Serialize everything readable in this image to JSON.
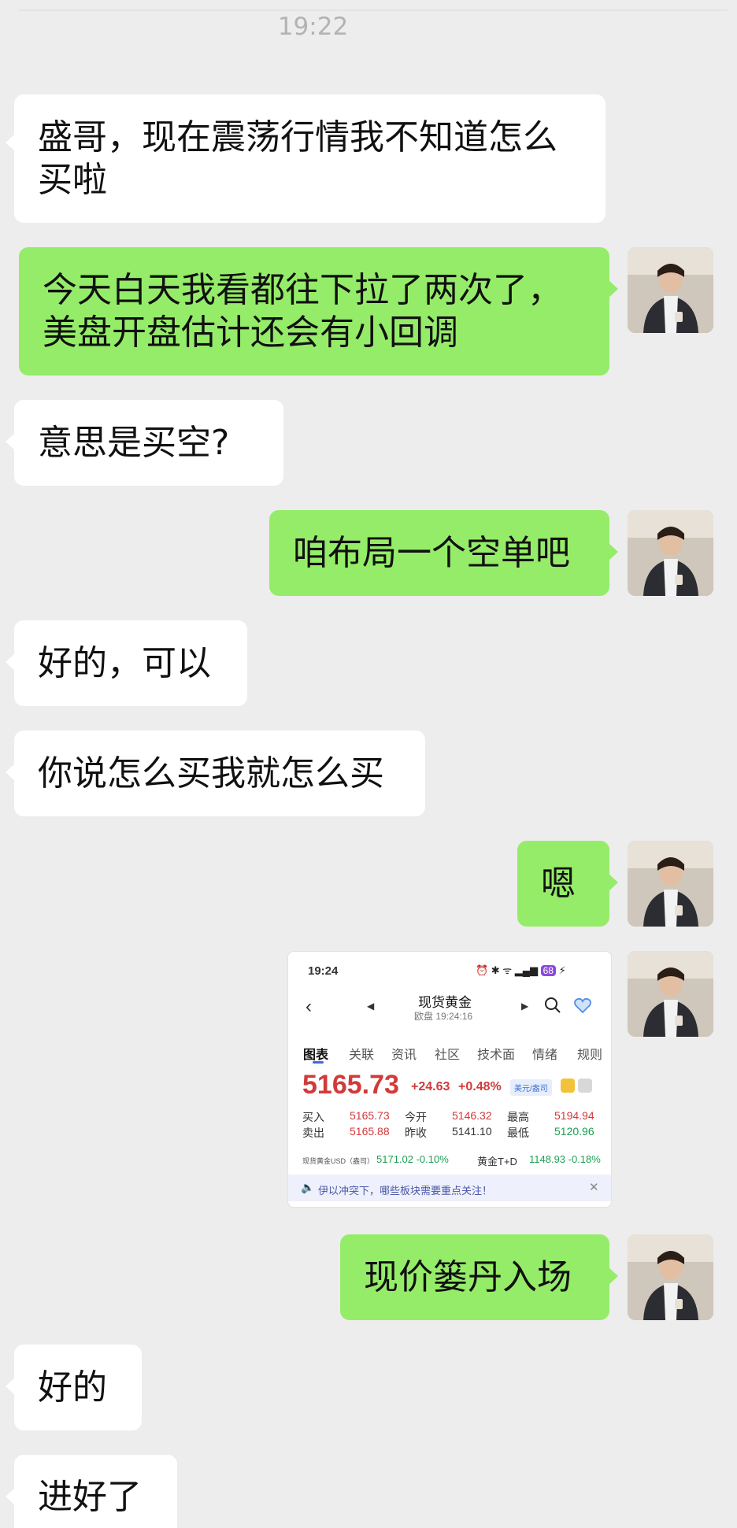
{
  "status_time": "19:22",
  "messages": [
    {
      "side": "in",
      "text": "盛哥，现在震荡行情我不知道怎么\n买啦"
    },
    {
      "side": "out",
      "text": "今天白天我看都往下拉了两次了，\n美盘开盘估计还会有小回调"
    },
    {
      "side": "in",
      "text": "意思是买空?"
    },
    {
      "side": "out",
      "text": "咱布局一个空单吧"
    },
    {
      "side": "in",
      "text": "好的，可以"
    },
    {
      "side": "in",
      "text": "你说怎么买我就怎么买"
    },
    {
      "side": "out",
      "text": "嗯"
    },
    {
      "side": "out",
      "text": "现价篓丹入场"
    },
    {
      "side": "in",
      "text": "好的"
    },
    {
      "side": "in",
      "text": "进好了"
    }
  ],
  "quote_card": {
    "status_time": "19:24",
    "battery": "68",
    "title": "现货黄金",
    "subtitle": "欧盘  19:24:16",
    "tabs": [
      "图表",
      "关联",
      "资讯",
      "社区",
      "技术面",
      "情绪",
      "规则"
    ],
    "price": "5165.73",
    "change": "+24.63",
    "change_pct": "+0.48%",
    "unit_badge": "美元/盎司",
    "rows": [
      {
        "l1": "买入",
        "v1": "5165.73",
        "l2": "今开",
        "v2": "5146.32",
        "l3": "最高",
        "v3": "5194.94"
      },
      {
        "l1": "卖出",
        "v1": "5165.88",
        "l2": "昨收",
        "v2": "5141.10",
        "l3": "最低",
        "v3": "5120.96"
      }
    ],
    "footer_left_label": "现货黄金USD（盎司）",
    "footer_left_value": "5171.02 -0.10%",
    "footer_right_label": "黄金T+D",
    "footer_right_value": "1148.93 -0.18%",
    "notice": "伊以冲突下，哪些板块需要重点关注！"
  },
  "colors": {
    "incoming_bubble": "#ffffff",
    "outgoing_bubble": "#95ec69",
    "background": "#ededed",
    "up_red": "#d23a3a",
    "down_green": "#1e9e52"
  }
}
